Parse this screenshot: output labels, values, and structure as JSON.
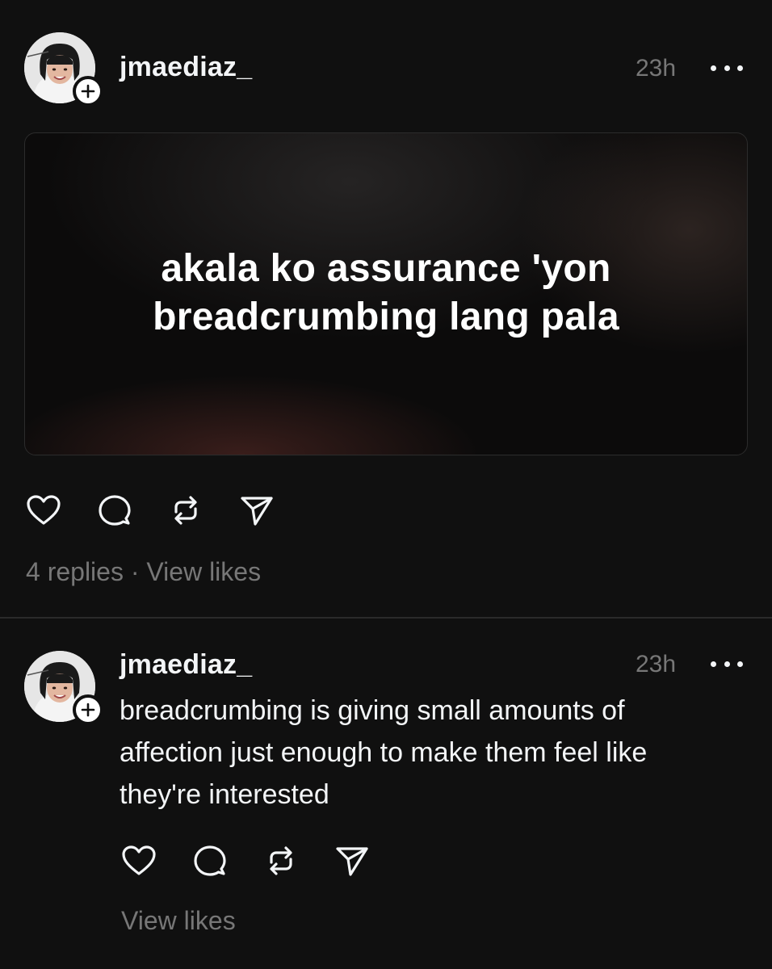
{
  "posts": [
    {
      "username": "jmaediaz_",
      "time": "23h",
      "media_text": [
        "akala ko assurance 'yon",
        "breadcrumbing lang pala"
      ],
      "replies": "4 replies",
      "separator": "·",
      "view_likes": "View likes"
    },
    {
      "username": "jmaediaz_",
      "time": "23h",
      "text": "breadcrumbing is giving small amounts of affection just enough to make them feel like they're interested",
      "view_likes": "View likes"
    }
  ],
  "icons": {
    "like": "heart-icon",
    "reply": "comment-icon",
    "repost": "repost-icon",
    "share": "send-icon",
    "more": "more-icon",
    "follow": "plus-icon"
  },
  "colors": {
    "background": "#101010",
    "text": "#f3f5f7",
    "muted": "#777777",
    "divider": "#2a2a2a"
  }
}
